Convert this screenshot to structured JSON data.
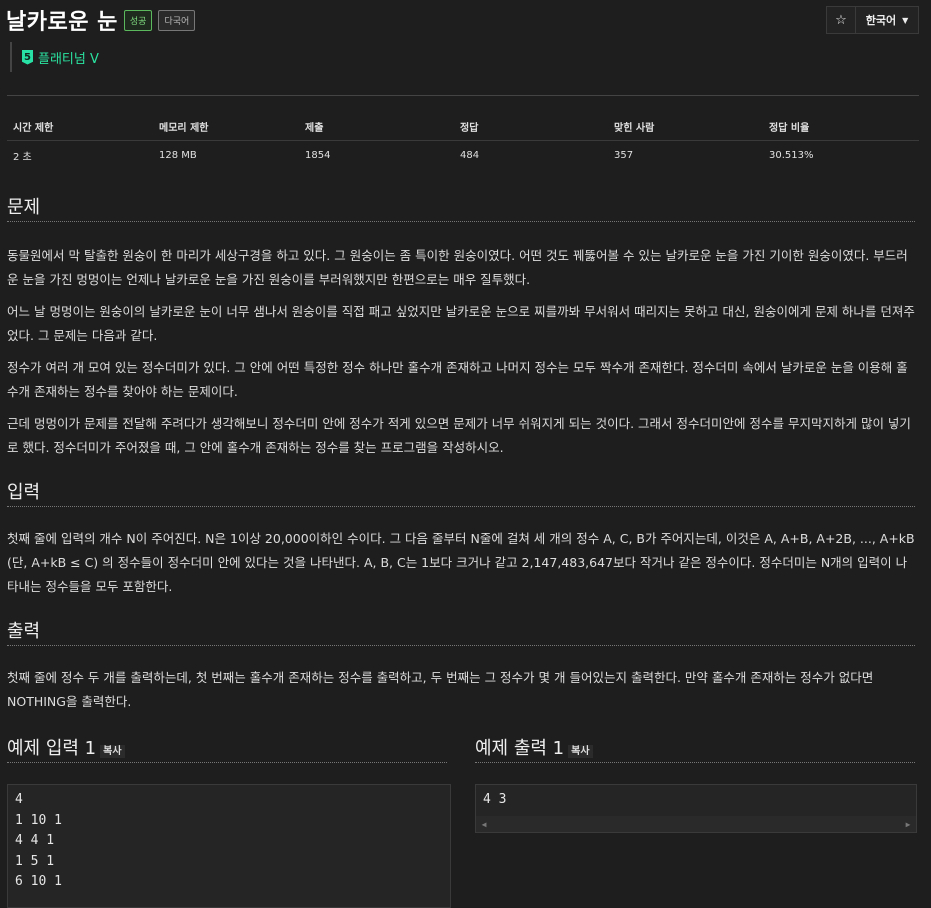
{
  "problem": {
    "title": "날카로운 눈",
    "badge_success": "성공",
    "badge_lang": "다국어"
  },
  "top": {
    "star_icon": "☆",
    "language": "한국어",
    "caret": "▼"
  },
  "tier": {
    "number": "5",
    "label": "플래티넘 V"
  },
  "stats": {
    "headers": [
      "시간 제한",
      "메모리 제한",
      "제출",
      "정답",
      "맞힌 사람",
      "정답 비율"
    ],
    "values": [
      "2 초",
      "128 MB",
      "1854",
      "484",
      "357",
      "30.513%"
    ]
  },
  "sections": {
    "problem_title": "문제",
    "problem_paras": [
      "동물원에서 막 탈출한 원숭이 한 마리가 세상구경을 하고 있다. 그 원숭이는 좀 특이한 원숭이였다. 어떤 것도 꿰뚫어볼 수 있는 날카로운 눈을 가진 기이한 원숭이였다. 부드러운 눈을 가진 멍멍이는 언제나 날카로운 눈을 가진 원숭이를 부러워했지만 한편으로는 매우 질투했다.",
      "어느 날 멍멍이는 원숭이의 날카로운 눈이 너무 샘나서 원숭이를 직접 패고 싶었지만 날카로운 눈으로 찌를까봐 무서워서 때리지는 못하고 대신, 원숭이에게 문제 하나를 던져주었다. 그 문제는 다음과 같다.",
      "정수가 여러 개 모여 있는 정수더미가 있다. 그 안에 어떤 특정한 정수 하나만 홀수개 존재하고 나머지 정수는 모두 짝수개 존재한다. 정수더미 속에서 날카로운 눈을 이용해 홀수개 존재하는 정수를 찾아야 하는 문제이다.",
      "근데 멍멍이가 문제를 전달해 주려다가 생각해보니 정수더미 안에 정수가 적게 있으면 문제가 너무 쉬워지게 되는 것이다. 그래서 정수더미안에 정수를 무지막지하게 많이 넣기로 했다. 정수더미가 주어졌을 때, 그 안에 홀수개 존재하는 정수를 찾는 프로그램을 작성하시오."
    ],
    "input_title": "입력",
    "input_para": "첫째 줄에 입력의 개수 N이 주어진다. N은 1이상 20,000이하인 수이다. 그 다음 줄부터 N줄에 걸쳐 세 개의 정수 A, C, B가 주어지는데, 이것은 A, A+B, A+2B, ..., A+kB (단, A+kB ≤ C) 의 정수들이 정수더미 안에 있다는 것을 나타낸다. A, B, C는 1보다 크거나 같고 2,147,483,647보다 작거나 같은 정수이다. 정수더미는 N개의 입력이 나타내는 정수들을 모두 포함한다.",
    "output_title": "출력",
    "output_para": "첫째 줄에 정수 두 개를 출력하는데, 첫 번째는 홀수개 존재하는 정수를 출력하고, 두 번째는 그 정수가 몇 개 들어있는지 출력한다. 만약 홀수개 존재하는 정수가 없다면 NOTHING을 출력한다."
  },
  "samples": {
    "input_title": "예제 입력 1",
    "output_title": "예제 출력 1",
    "copy_label": "복사",
    "input_lines": [
      "4",
      "1 10 1",
      "4 4 1",
      "1 5 1",
      "6 10 1"
    ],
    "output_lines": [
      "4 3"
    ],
    "scroll_left": "◀",
    "scroll_right": "▶"
  }
}
